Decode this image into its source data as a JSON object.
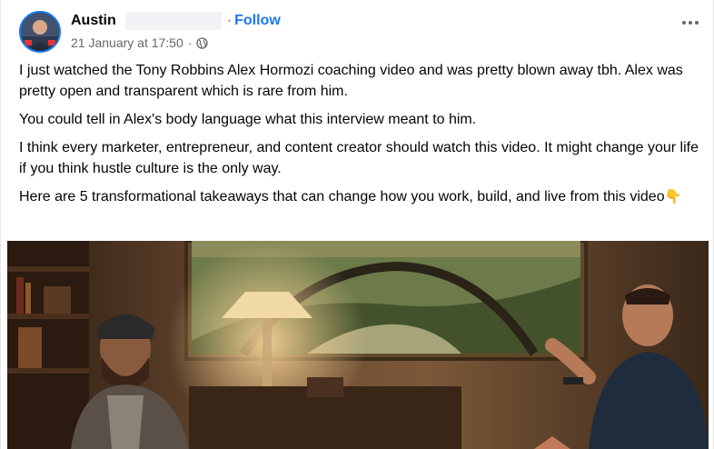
{
  "post": {
    "author": "Austin",
    "follow_label": "Follow",
    "separator": "·",
    "timestamp": "21 January at 17:50",
    "audience_icon": "globe-icon",
    "more_icon": "more-options-icon",
    "paragraphs": [
      "I just watched the Tony Robbins Alex Hormozi coaching video and was pretty blown away tbh. Alex was pretty open and transparent which is rare from him.",
      "You could tell in Alex's body language what this interview meant to him.",
      "I think every marketer, entrepreneur, and content creator should watch this video. It might change your life if you think hustle culture is the only way.",
      "Here are 5 transformational takeaways that can change how you work, build, and live from this video"
    ],
    "last_paragraph_emoji": "👇"
  },
  "colors": {
    "accent": "#1877f2",
    "secondary_text": "#65676b",
    "primary_text": "#050505"
  }
}
